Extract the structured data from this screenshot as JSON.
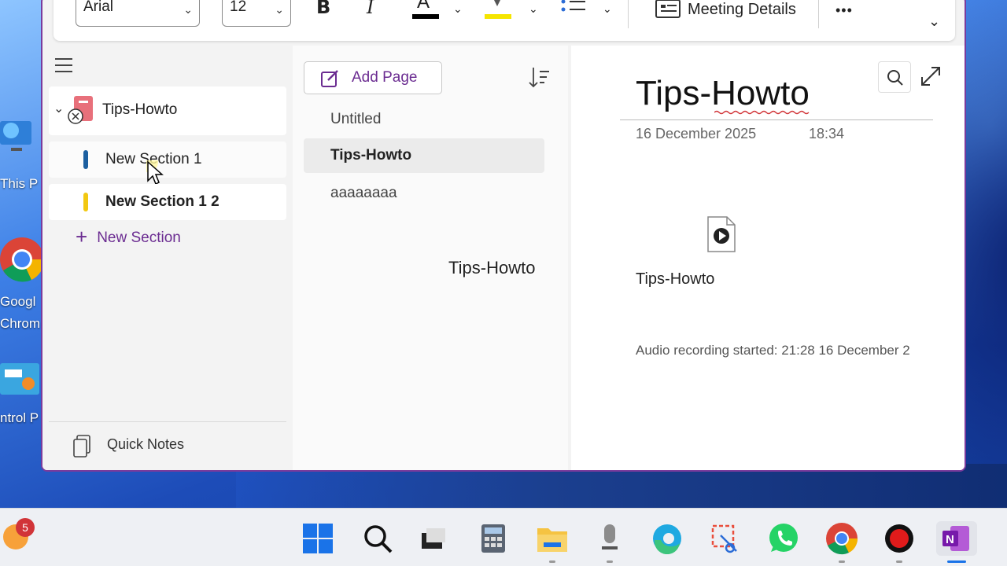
{
  "desktop": {
    "icons": [
      {
        "name": "this-pc",
        "label": "This P"
      },
      {
        "name": "google-chrome",
        "label": "Googl",
        "label2": "Chrom"
      },
      {
        "name": "control-panel",
        "label": "ntrol P"
      }
    ]
  },
  "ribbon": {
    "font_name": "Arial",
    "font_size": "12",
    "bold": "B",
    "italic": "I",
    "font_color_glyph": "A",
    "meeting_details": "Meeting Details",
    "more": "•••"
  },
  "nav": {
    "notebook": "Tips-Howto",
    "sections": [
      {
        "label": "New Section 1",
        "color": "#1c5fa0"
      },
      {
        "label": "New Section 1 2",
        "color": "#f2c811"
      }
    ],
    "new_section": "New Section",
    "quick_notes": "Quick Notes"
  },
  "pages": {
    "add_page": "Add Page",
    "items": [
      "Untitled",
      "Tips-Howto",
      "aaaaaaaa"
    ],
    "drag_caption": "Tips-Howto"
  },
  "content": {
    "title": "Tips-Howto",
    "date": "16 December 2025",
    "time": "18:34",
    "attachment_label": "Tips-Howto",
    "audio_note": "Audio recording started: 21:28 16 December 2"
  },
  "taskbar": {
    "badge_count": "5",
    "apps": [
      "start",
      "search",
      "task-view",
      "calculator",
      "file-explorer",
      "voice-recorder",
      "edge",
      "snipping-tool",
      "whatsapp",
      "chrome",
      "record",
      "onenote"
    ]
  },
  "colors": {
    "accent": "#6b2c91",
    "window_border": "#7a3b9c"
  }
}
